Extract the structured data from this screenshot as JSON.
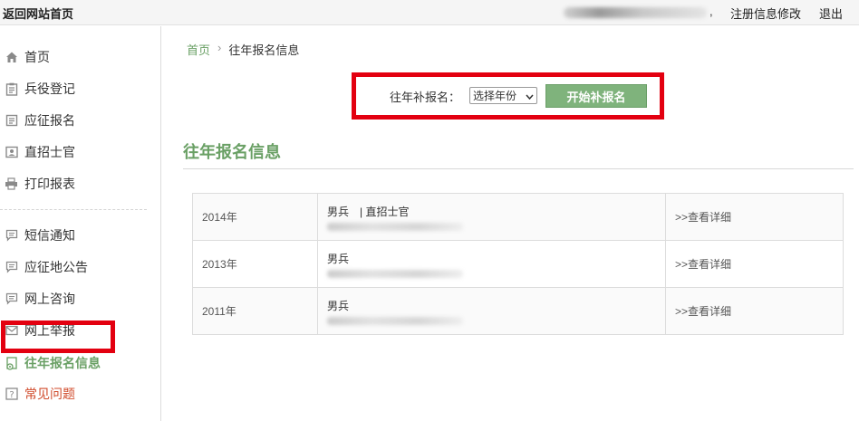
{
  "topbar": {
    "home_link": "返回网站首页",
    "comma": ",",
    "register_edit": "注册信息修改",
    "logout": "退出"
  },
  "sidebar": {
    "items": [
      {
        "label": "首页",
        "icon": "home-icon"
      },
      {
        "label": "兵役登记",
        "icon": "clipboard-icon"
      },
      {
        "label": "应征报名",
        "icon": "form-icon"
      },
      {
        "label": "直招士官",
        "icon": "id-card-icon"
      },
      {
        "label": "打印报表",
        "icon": "printer-icon"
      },
      {
        "label": "短信通知",
        "icon": "message-icon"
      },
      {
        "label": "应征地公告",
        "icon": "announcement-icon"
      },
      {
        "label": "网上咨询",
        "icon": "chat-icon"
      },
      {
        "label": "网上举报",
        "icon": "mail-icon"
      },
      {
        "label": "往年报名信息",
        "icon": "history-doc-icon"
      },
      {
        "label": "常见问题",
        "icon": "question-icon"
      }
    ]
  },
  "breadcrumb": {
    "home": "首页",
    "separator": "›",
    "current": "往年报名信息"
  },
  "redo": {
    "label": "往年补报名：",
    "select_value": "选择年份",
    "start_button": "开始补报名"
  },
  "section": {
    "title": "往年报名信息"
  },
  "records": [
    {
      "year": "2014年",
      "type": "男兵　| 直招士官",
      "action": ">>查看详细"
    },
    {
      "year": "2013年",
      "type": "男兵",
      "action": ">>查看详细"
    },
    {
      "year": "2011年",
      "type": "男兵",
      "action": ">>查看详细"
    }
  ],
  "colors": {
    "accent_green": "#6aa065",
    "button_green": "#7fb37c",
    "highlight_red": "#e30010",
    "faq_red": "#d04a2a"
  }
}
